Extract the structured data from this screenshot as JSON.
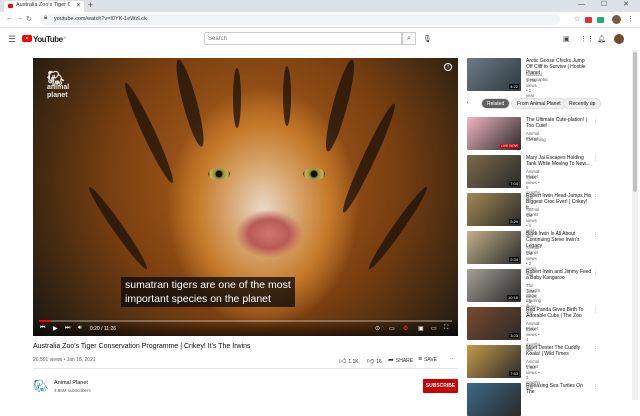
{
  "browser": {
    "tab_title": "Australia Zoo's Tiger Conserv...",
    "new_tab": "+",
    "url": "youtube.com/watch?v=I0YK-1eWzLck",
    "lock_icon": "lock-icon",
    "back": "←",
    "forward": "→",
    "reload": "↻",
    "star": "☆",
    "window_controls": "— ☐ ✕"
  },
  "youtube": {
    "logo_text": "YouTube",
    "logo_sup": "CA",
    "search_placeholder": "Search",
    "search_icon": "search-icon",
    "mic_icon": "mic-icon"
  },
  "player": {
    "brand_line1": "animal",
    "brand_line2": "planet",
    "caption_line1": "sumatran tigers are one of the most",
    "caption_line2": "important species on the planet",
    "time": "0:20 / 11:26",
    "progress": 0.029,
    "info": "i"
  },
  "video": {
    "title": "Australia Zoo's Tiger Conservation Programme | Crikey! It's The Irwins",
    "meta": "20,591 views • Jan 18, 2021",
    "likes": "1.1K",
    "dislikes": "16",
    "share": "SHARE",
    "save": "SAVE",
    "more": "⋯"
  },
  "channel": {
    "name": "Animal Planet",
    "subs": "4.85M subscribers",
    "subscribe": "SUBSCRIBE"
  },
  "sidebar": {
    "top": {
      "title": "Arctic Goose Chicks Jump Off Cliff to Survive | Hostile Planet",
      "channel": "National Geographic",
      "meta": "1.7M views • 1 year ago",
      "duration": "4:22"
    },
    "chips": [
      "Related",
      "From Animal Planet",
      "Recently up"
    ],
    "items": [
      {
        "title": "The Ultimate Cute-plation! | Too Cute!",
        "channel": "Animal Planet",
        "meta": "Streaming",
        "badge": "LIVE NOW",
        "color": "#f2b6c3"
      },
      {
        "title": "Mary Jai Escapes Holding Tank While Moving To New...",
        "channel": "Animal Planet",
        "meta": "494K views • 9 months ago",
        "duration": "7:04",
        "color": "#7a6a4a"
      },
      {
        "title": "Robert Irwin Head-Jumps His Biggest Croc Ever! | Crikey! It...",
        "channel": "Animal Planet",
        "meta": "1M views • 1 year ago",
        "duration": "5:29",
        "color": "#a38a55"
      },
      {
        "title": "Bindi Irwin Is All About Continuing Steve Irwin's Legacy",
        "channel": "Animal Planet",
        "meta": "1M views • 2 years ago",
        "duration": "2:34",
        "color": "#c2b28a"
      },
      {
        "title": "Robert Irwin and Jimmy Feed a Baby Kangaroo",
        "channel": "The Tonight Show Starring Ji...",
        "meta": "14M views • 3 years ago",
        "duration": "10:18",
        "color": "#a5a09a"
      },
      {
        "title": "Red Panda Gives Birth To Adorable Cubs | The Zoo",
        "channel": "Animal Planet",
        "meta": "537K views • 4 months ago",
        "duration": "3:23",
        "color": "#7a4a2a"
      },
      {
        "title": "Meet Dexter The Cuddly Koala! | Wild Times",
        "channel": "Animal Planet",
        "meta": "1.6M views • 3 months ago",
        "duration": "7:53",
        "color": "#c69a4a"
      },
      {
        "title": "Releasing Sea Turtles On The",
        "channel": "",
        "meta": "",
        "duration": "",
        "color": "#3a6a8a"
      }
    ]
  },
  "colors": {
    "accent": "#ff0000",
    "subscribe": "#cc0000",
    "live": "#cc0000"
  }
}
